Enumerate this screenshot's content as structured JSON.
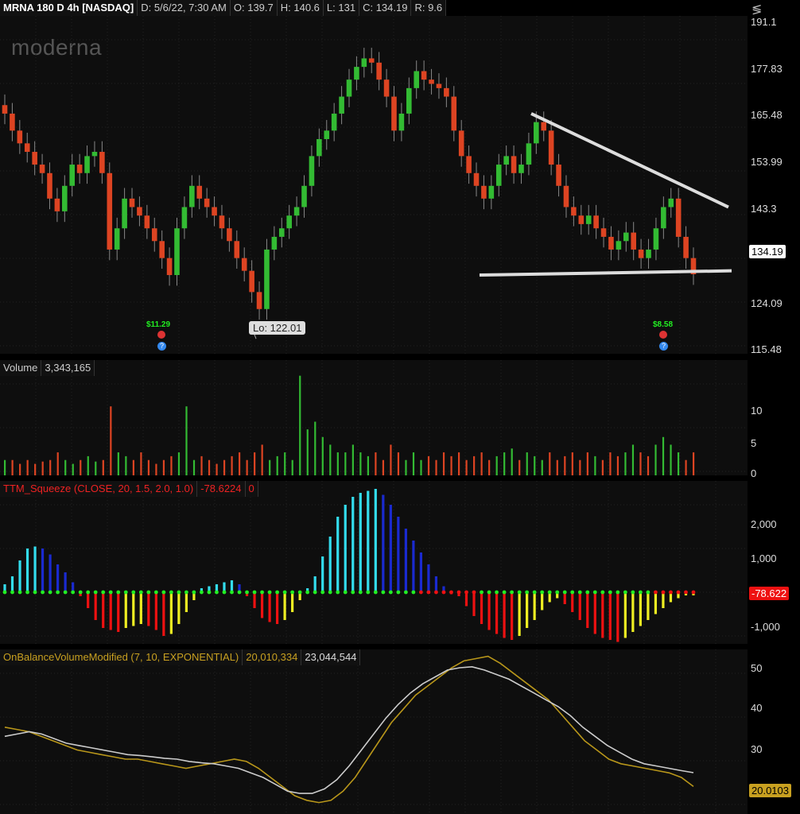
{
  "header": {
    "symbol": "MRNA 180 D 4h [NASDAQ]",
    "date": "D: 5/6/22, 7:30 AM",
    "open": "O: 139.7",
    "high": "H: 140.6",
    "low": "L: 131",
    "close": "C: 134.19",
    "range": "R: 9.6"
  },
  "logo": "moderna",
  "price_axis": {
    "ticks": [
      "191.1",
      "177.83",
      "165.48",
      "153.99",
      "143.3",
      "124.09",
      "115.48"
    ],
    "last": "134.19"
  },
  "annotations": {
    "low_label": "Lo: 122.01",
    "div1": "$11.29",
    "div2": "$8.58"
  },
  "volume": {
    "label": "Volume",
    "value": "3,343,165",
    "ticks": [
      "10",
      "5",
      "0"
    ]
  },
  "squeeze": {
    "label": "TTM_Squeeze (CLOSE, 20, 1.5, 2.0, 1.0)",
    "value": "-78.6224",
    "flag": "0",
    "ticks": [
      "2,000",
      "1,000",
      "-1,000"
    ],
    "last": "-78.622"
  },
  "obv": {
    "label": "OnBalanceVolumeModified (7, 10, EXPONENTIAL)",
    "value1": "20,010,334",
    "value2": "23,044,544",
    "ticks": [
      "50",
      "40",
      "30"
    ],
    "last": "20.0103"
  },
  "colors": {
    "up": "#33bb33",
    "down": "#dd4422",
    "cyan": "#33ddee",
    "blue": "#1a2ad0",
    "red": "#ee1111",
    "yellow": "#eeee22",
    "dot_green": "#22ee22",
    "obv1": "#b8961a",
    "obv2": "#cccccc"
  },
  "chart_data": [
    {
      "type": "candlestick",
      "ylim": [
        115.48,
        195
      ],
      "closes": [
        172,
        168,
        165,
        163,
        160,
        158,
        152,
        149,
        155,
        160,
        158,
        162,
        163,
        158,
        140,
        145,
        152,
        150,
        148,
        145,
        142,
        138,
        134,
        145,
        150,
        155,
        152,
        150,
        148,
        145,
        142,
        138,
        135,
        130,
        126,
        140,
        143,
        145,
        148,
        150,
        155,
        162,
        166,
        168,
        172,
        176,
        180,
        183,
        185,
        184,
        180,
        176,
        168,
        172,
        178,
        182,
        180,
        179,
        178,
        176,
        168,
        162,
        158,
        155,
        152,
        155,
        160,
        162,
        158,
        160,
        165,
        170,
        168,
        160,
        155,
        150,
        148,
        146,
        148,
        145,
        143,
        140,
        142,
        144,
        140,
        138,
        140,
        145,
        150,
        152,
        143,
        138,
        134.19
      ]
    },
    {
      "type": "bar",
      "name": "Volume",
      "ylim": [
        0,
        14
      ],
      "values": [
        2,
        2,
        1.5,
        2,
        1.5,
        1.8,
        2,
        3,
        2,
        1.5,
        2,
        2.5,
        1.8,
        2,
        9,
        3,
        2.5,
        2,
        3,
        2,
        1.5,
        2,
        2.5,
        3,
        9,
        2,
        2.5,
        2,
        1.5,
        2,
        2.5,
        3,
        2,
        3,
        4,
        2,
        2.5,
        3,
        2,
        13,
        6,
        7,
        5,
        4,
        3,
        3,
        4,
        3,
        2.5,
        3,
        2,
        4,
        3,
        2,
        3,
        2,
        2.5,
        2,
        3,
        2.5,
        3,
        2,
        2.5,
        3,
        2,
        2.5,
        3,
        3.5,
        2,
        3,
        2.5,
        2,
        3,
        2,
        2.5,
        3,
        2,
        3,
        2.5,
        2,
        3,
        2.5,
        3,
        4,
        3,
        2.5,
        4,
        5,
        4,
        3,
        2,
        3
      ]
    },
    {
      "type": "histogram",
      "name": "TTM_Squeeze",
      "ylim": [
        -1300,
        2800
      ],
      "values": [
        200,
        400,
        800,
        1100,
        1150,
        1100,
        950,
        700,
        500,
        250,
        -100,
        -400,
        -700,
        -900,
        -950,
        -1000,
        -900,
        -850,
        -800,
        -850,
        -950,
        -1100,
        -1050,
        -800,
        -500,
        -200,
        100,
        150,
        200,
        250,
        300,
        200,
        -100,
        -400,
        -650,
        -750,
        -800,
        -700,
        -500,
        -200,
        100,
        400,
        900,
        1400,
        1900,
        2200,
        2400,
        2500,
        2550,
        2600,
        2450,
        2200,
        1900,
        1600,
        1300,
        1000,
        700,
        400,
        150,
        -50,
        -100,
        -350,
        -600,
        -800,
        -950,
        -1050,
        -1150,
        -1200,
        -1100,
        -900,
        -700,
        -450,
        -250,
        -150,
        -300,
        -500,
        -700,
        -900,
        -1050,
        -1150,
        -1200,
        -1250,
        -1150,
        -1000,
        -850,
        -700,
        -550,
        -400,
        -250,
        -150,
        -80,
        -78.622
      ]
    },
    {
      "type": "line",
      "name": "OnBalanceVolume",
      "ylim": [
        14,
        50
      ],
      "series": [
        {
          "values": [
            33,
            32.5,
            32,
            31,
            30,
            29,
            28,
            27.5,
            27,
            26.5,
            26,
            26,
            25.5,
            25,
            24.5,
            24,
            24.5,
            25,
            25.5,
            26,
            25.5,
            24,
            22,
            20,
            18,
            17,
            16.5,
            17,
            19,
            22,
            26,
            30,
            34,
            37,
            40,
            42,
            44,
            46,
            47.5,
            48,
            48.5,
            47,
            45,
            43,
            41,
            39,
            36,
            33,
            30,
            28,
            26,
            25,
            24.5,
            24,
            23.5,
            23,
            22,
            20.01
          ]
        },
        {
          "values": [
            31,
            31.5,
            32,
            31.5,
            30.5,
            29.5,
            29,
            28.5,
            28,
            27.5,
            27,
            26.8,
            26.5,
            26.2,
            26,
            25.5,
            25.2,
            25,
            24.5,
            24,
            23,
            22,
            20.5,
            19,
            18.5,
            18.5,
            19.5,
            21.5,
            24.5,
            28,
            31.5,
            35,
            38,
            40.5,
            42.5,
            44,
            45.5,
            46,
            46.2,
            45.5,
            44.5,
            43.5,
            42,
            40.5,
            39,
            37.5,
            35.5,
            33,
            31,
            29,
            27.5,
            26,
            25,
            24.5,
            24,
            23.5,
            23.04
          ]
        }
      ]
    }
  ]
}
